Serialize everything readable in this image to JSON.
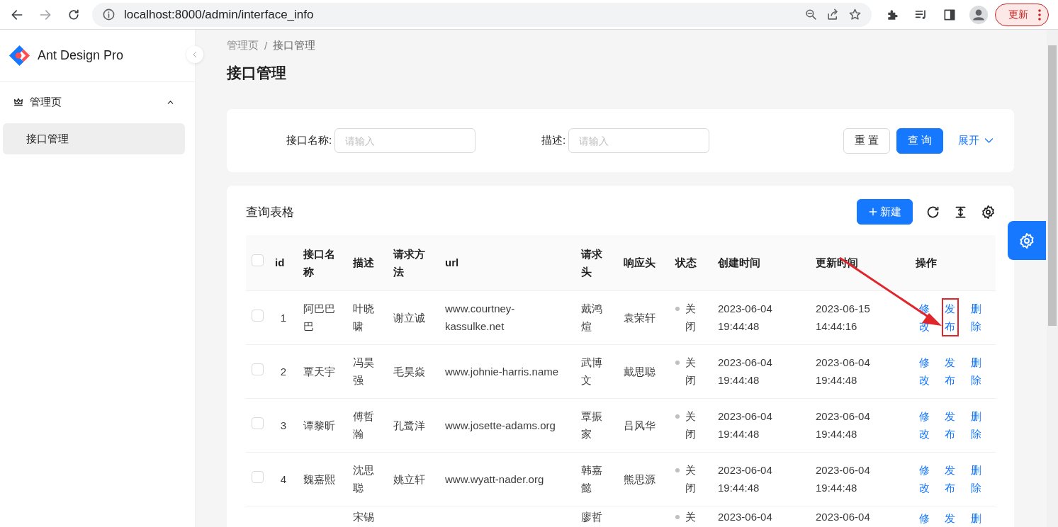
{
  "browser": {
    "url": "localhost:8000/admin/interface_info",
    "update_button": "更新"
  },
  "sidebar": {
    "logo_text": "Ant Design Pro",
    "menu": [
      {
        "label": "管理页",
        "expanded": true,
        "children": [
          {
            "label": "接口管理",
            "selected": true
          }
        ]
      }
    ]
  },
  "breadcrumb": {
    "items": [
      "管理页",
      "接口管理"
    ],
    "separator": "/"
  },
  "page_title": "接口管理",
  "search_form": {
    "fields": [
      {
        "label": "接口名称:",
        "placeholder": "请输入"
      },
      {
        "label": "描述:",
        "placeholder": "请输入"
      }
    ],
    "reset_button": "重 置",
    "query_button": "查 询",
    "expand_link": "展开"
  },
  "table": {
    "title": "查询表格",
    "new_button": "新建",
    "select_all_checked": false,
    "columns": [
      "id",
      "接口名称",
      "描述",
      "请求方法",
      "url",
      "请求头",
      "响应头",
      "状态",
      "创建时间",
      "更新时间",
      "操作"
    ],
    "rows": [
      {
        "checked": false,
        "cells": [
          "1",
          "阿巴巴巴",
          "叶晓啸",
          "谢立诚",
          "www.courtney-kassulke.net",
          "戴鸿煊",
          "袁荣轩"
        ],
        "status": {
          "text": "关闭",
          "color": "#bfbfbf"
        },
        "created": "2023-06-04 19:44:48",
        "updated": "2023-06-15 14:44:16",
        "actions": [
          {
            "label": "修改",
            "highlighted": false
          },
          {
            "label": "发布",
            "highlighted": true
          },
          {
            "label": "删除",
            "highlighted": false
          }
        ]
      },
      {
        "checked": false,
        "cells": [
          "2",
          "覃天宇",
          "冯昊强",
          "毛昊焱",
          "www.johnie-harris.name",
          "武博文",
          "戴思聪"
        ],
        "status": {
          "text": "关闭",
          "color": "#bfbfbf"
        },
        "created": "2023-06-04 19:44:48",
        "updated": "2023-06-04 19:44:48",
        "actions": [
          {
            "label": "修改",
            "highlighted": false
          },
          {
            "label": "发布",
            "highlighted": false
          },
          {
            "label": "删除",
            "highlighted": false
          }
        ]
      },
      {
        "checked": false,
        "cells": [
          "3",
          "谭黎昕",
          "傅哲瀚",
          "孔鹭洋",
          "www.josette-adams.org",
          "覃振家",
          "吕风华"
        ],
        "status": {
          "text": "关闭",
          "color": "#bfbfbf"
        },
        "created": "2023-06-04 19:44:48",
        "updated": "2023-06-04 19:44:48",
        "actions": [
          {
            "label": "修改",
            "highlighted": false
          },
          {
            "label": "发布",
            "highlighted": false
          },
          {
            "label": "删除",
            "highlighted": false
          }
        ]
      },
      {
        "checked": false,
        "cells": [
          "4",
          "魏嘉熙",
          "沈思聪",
          "姚立轩",
          "www.wyatt-nader.org",
          "韩嘉懿",
          "熊思源"
        ],
        "status": {
          "text": "关闭",
          "color": "#bfbfbf"
        },
        "created": "2023-06-04 19:44:48",
        "updated": "2023-06-04 19:44:48",
        "actions": [
          {
            "label": "修改",
            "highlighted": false
          },
          {
            "label": "发布",
            "highlighted": false
          },
          {
            "label": "删除",
            "highlighted": false
          }
        ]
      }
    ],
    "partial_row": {
      "description": "宋锡",
      "request_header": "廖哲",
      "status": {
        "text": "关",
        "color": "#bfbfbf"
      },
      "created": "2023-06-04",
      "updated": "2023-06-04",
      "actions": [
        "修",
        "发",
        "删"
      ]
    }
  }
}
